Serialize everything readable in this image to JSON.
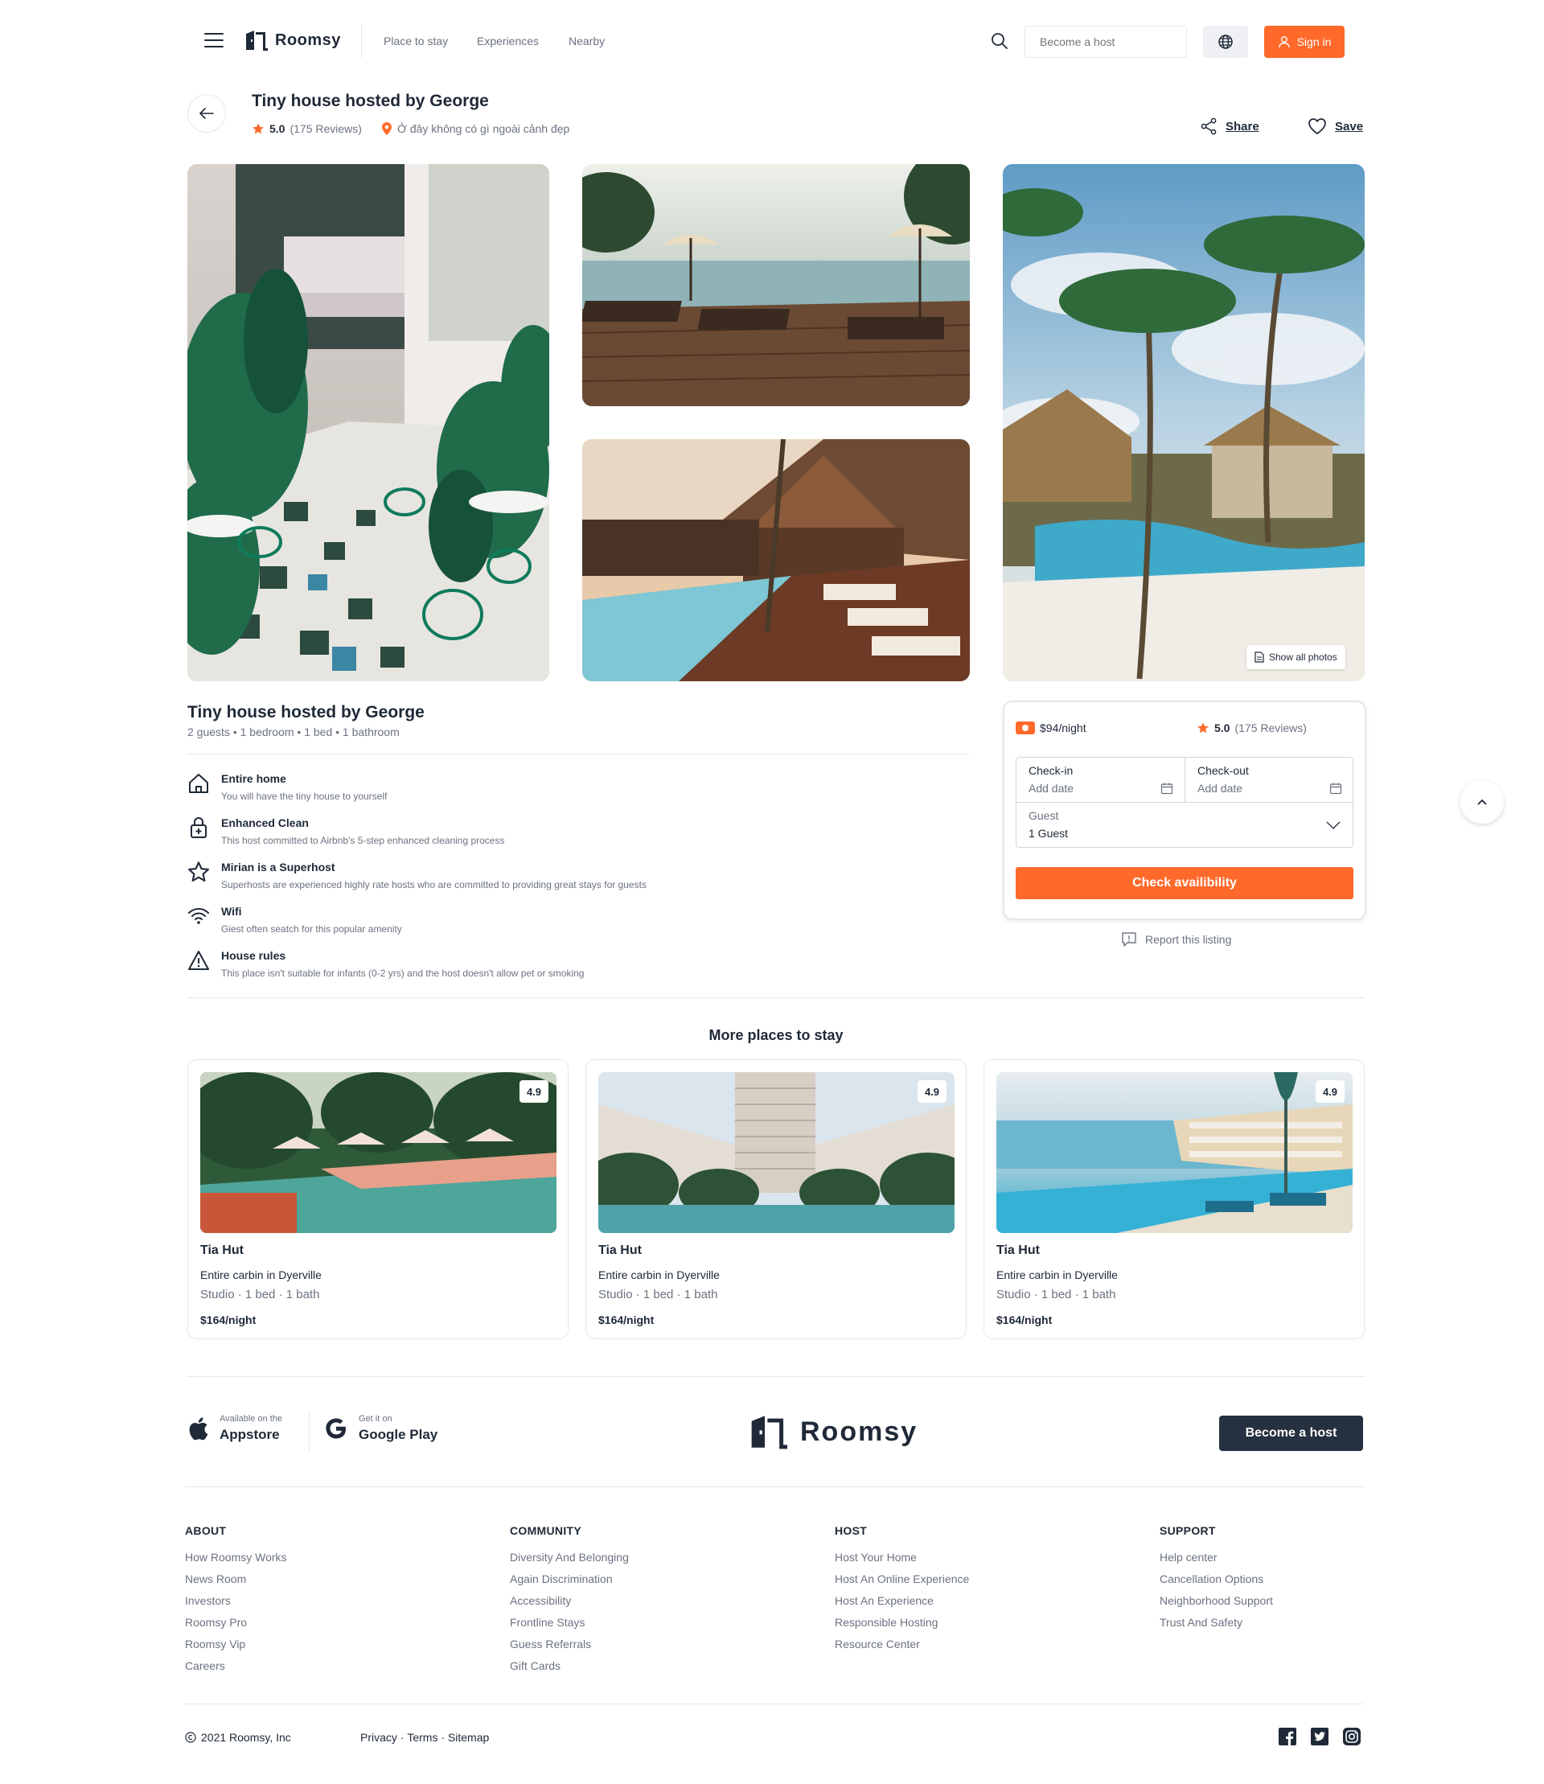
{
  "header": {
    "brand": "Roomsy",
    "nav": [
      "Place to stay",
      "Experiences",
      "Nearby"
    ],
    "host_placeholder": "Become a host",
    "signin_label": "Sign in"
  },
  "listing": {
    "title": "Tiny house hosted by George",
    "rating": "5.0",
    "reviews": "(175 Reviews)",
    "location": "Ở đây không có gì ngoài cảnh đẹp",
    "share_label": "Share",
    "save_label": "Save",
    "show_all_label": "Show all photos"
  },
  "details": {
    "title": "Tiny house hosted by George",
    "subtitle": "2 guests • 1 bedroom • 1 bed • 1 bathroom",
    "features": [
      {
        "title": "Entire home",
        "desc": "You will have the tiny house to yourself",
        "icon": "home-icon"
      },
      {
        "title": "Enhanced Clean",
        "desc": "This host committed to Airbnb's 5-step enhanced cleaning process",
        "icon": "clean-lock-icon"
      },
      {
        "title": "Mirian is a Superhost",
        "desc": "Superhosts are experienced highly rate hosts who are committed to providing great stays for guests",
        "icon": "star-icon"
      },
      {
        "title": "Wifi",
        "desc": "Giest often seatch for this popular amenity",
        "icon": "wifi-icon"
      },
      {
        "title": "House rules",
        "desc": "This place isn't suitable for infants (0-2 yrs) and the host doesn't allow pet or smoking",
        "icon": "warning-icon"
      }
    ]
  },
  "booking": {
    "price": "$94/night",
    "rating": "5.0",
    "reviews": "(175 Reviews)",
    "checkin_label": "Check-in",
    "checkin_value": "Add date",
    "checkout_label": "Check-out",
    "checkout_value": "Add date",
    "guest_label": "Guest",
    "guest_value": "1 Guest",
    "button": "Check availibility",
    "report": "Report this listing"
  },
  "more": {
    "title": "More places to stay",
    "cards": [
      {
        "rating": "4.9",
        "name": "Tia Hut",
        "type": "Entire carbin in Dyerville",
        "info": "Studio · 1 bed · 1 bath",
        "price": "$164/night"
      },
      {
        "rating": "4.9",
        "name": "Tia Hut",
        "type": "Entire carbin in Dyerville",
        "info": "Studio · 1 bed · 1 bath",
        "price": "$164/night"
      },
      {
        "rating": "4.9",
        "name": "Tia Hut",
        "type": "Entire carbin in Dyerville",
        "info": "Studio · 1 bed · 1 bath",
        "price": "$164/night"
      }
    ]
  },
  "footer": {
    "appstore_small": "Available on the",
    "appstore_big": "Appstore",
    "gplay_small": "Get it on",
    "gplay_big": "Google Play",
    "brand": "Roomsy",
    "host_button": "Become a host",
    "columns": [
      {
        "title": "ABOUT",
        "links": [
          "How Roomsy Works",
          "News Room",
          "Investors",
          "Roomsy Pro",
          "Roomsy Vip",
          "Careers"
        ]
      },
      {
        "title": "COMMUNITY",
        "links": [
          "Diversity And Belonging",
          "Again Discrimination",
          "Accessibility",
          "Frontline Stays",
          "Guess Referrals",
          "Gift Cards"
        ]
      },
      {
        "title": "HOST",
        "links": [
          "Host Your Home",
          "Host An Online Experience",
          "Host An Experience",
          "Responsible Hosting",
          "Resource Center"
        ]
      },
      {
        "title": "SUPPORT",
        "links": [
          "Help center",
          "Cancellation Options",
          "Neighborhood Support",
          "Trust And Safety"
        ]
      }
    ],
    "copyright": "2021 Roomsy, Inc",
    "legal": [
      "Privacy",
      "Terms",
      "Sitemap"
    ],
    "legal_sep": " · "
  },
  "colors": {
    "accent": "#ff6a2b",
    "dark": "#253040",
    "muted": "#6b7280"
  }
}
